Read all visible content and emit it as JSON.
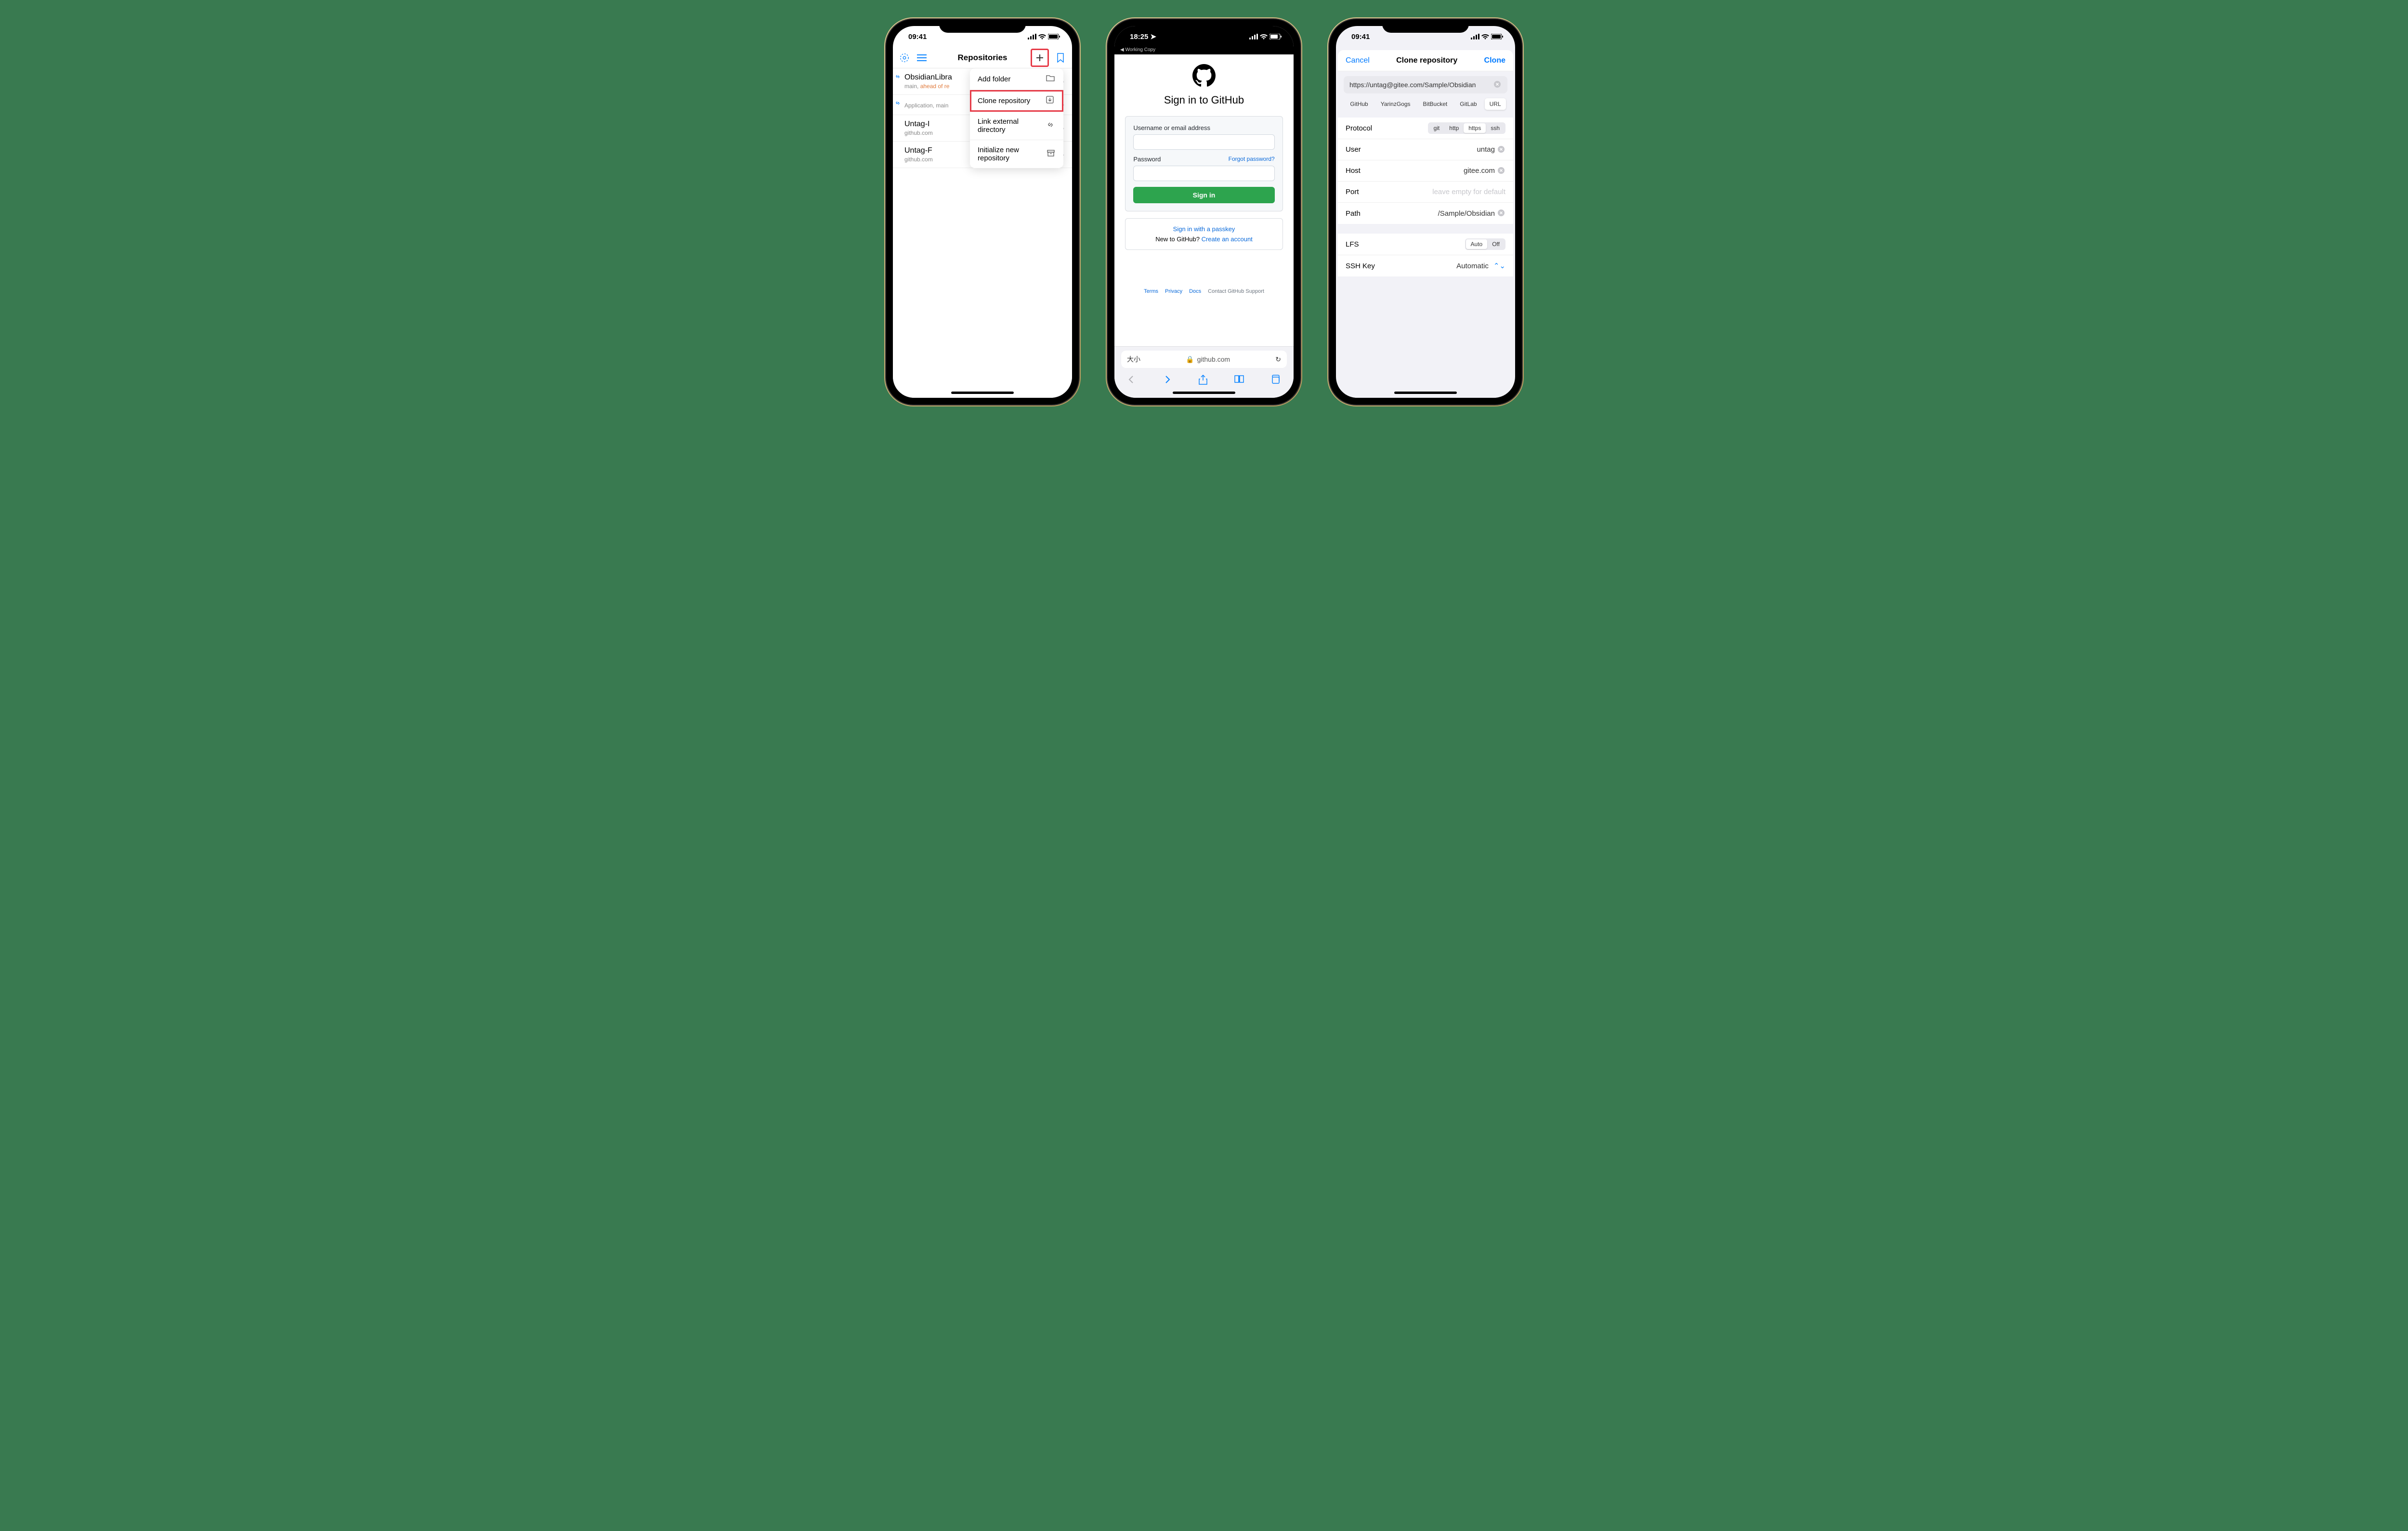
{
  "screen1": {
    "time": "09:41",
    "title": "Repositories",
    "repos": [
      {
        "name": "ObsidianLibra",
        "sub_prefix": "main, ",
        "sub_ahead": "ahead of re"
      },
      {
        "name": "",
        "sub": "Application, main"
      },
      {
        "name": "Untag-I",
        "sub": "github.com"
      },
      {
        "name": "Untag-F",
        "sub": "github.com"
      }
    ],
    "menu": {
      "add_folder": "Add folder",
      "clone_repo": "Clone repository",
      "link_external": "Link external directory",
      "init_repo": "Initialize new repository"
    }
  },
  "screen2": {
    "time": "18:25",
    "breadcrumb": "◀ Working Copy",
    "title": "Sign in to GitHub",
    "username_label": "Username or email address",
    "password_label": "Password",
    "forgot": "Forgot password?",
    "signin_btn": "Sign in",
    "passkey_link": "Sign in with a passkey",
    "new_prefix": "New to GitHub? ",
    "create_account": "Create an account",
    "footer": {
      "terms": "Terms",
      "privacy": "Privacy",
      "docs": "Docs",
      "support": "Contact GitHub Support"
    },
    "url_aa": "大小",
    "url_domain": "github.com"
  },
  "screen3": {
    "time": "09:41",
    "cancel": "Cancel",
    "title": "Clone repository",
    "clone_btn": "Clone",
    "url": "https://untag@gitee.com/Sample/Obsidian",
    "providers": [
      "GitHub",
      "YarinzGogs",
      "BitBucket",
      "GitLab",
      "URL"
    ],
    "provider_active": "URL",
    "protocol_label": "Protocol",
    "protocols": [
      "git",
      "http",
      "https",
      "ssh"
    ],
    "protocol_active": "https",
    "user_label": "User",
    "user_value": "untag",
    "host_label": "Host",
    "host_value": "gitee.com",
    "port_label": "Port",
    "port_placeholder": "leave empty for default",
    "path_label": "Path",
    "path_value": "/Sample/Obsidian",
    "lfs_label": "LFS",
    "lfs_options": [
      "Auto",
      "Off"
    ],
    "lfs_active": "Auto",
    "sshkey_label": "SSH Key",
    "sshkey_value": "Automatic"
  }
}
